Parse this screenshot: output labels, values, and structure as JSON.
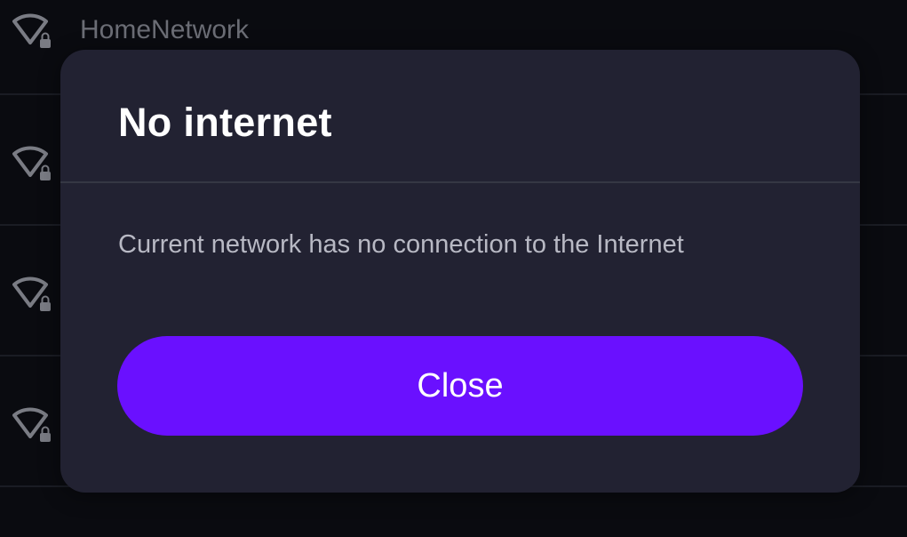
{
  "background": {
    "networks": [
      {
        "name": "HomeNetwork",
        "icon": "wifi-locked-icon"
      },
      {
        "name": "",
        "icon": "wifi-locked-icon"
      },
      {
        "name": "",
        "icon": "wifi-locked-icon"
      },
      {
        "name": "",
        "icon": "wifi-locked-icon"
      }
    ]
  },
  "dialog": {
    "title": "No internet",
    "message": "Current network has no connection to the Internet",
    "close_label": "Close"
  },
  "colors": {
    "accent": "#6a10ff",
    "dialog_bg": "#222232",
    "screen_bg": "#0a0b10"
  }
}
